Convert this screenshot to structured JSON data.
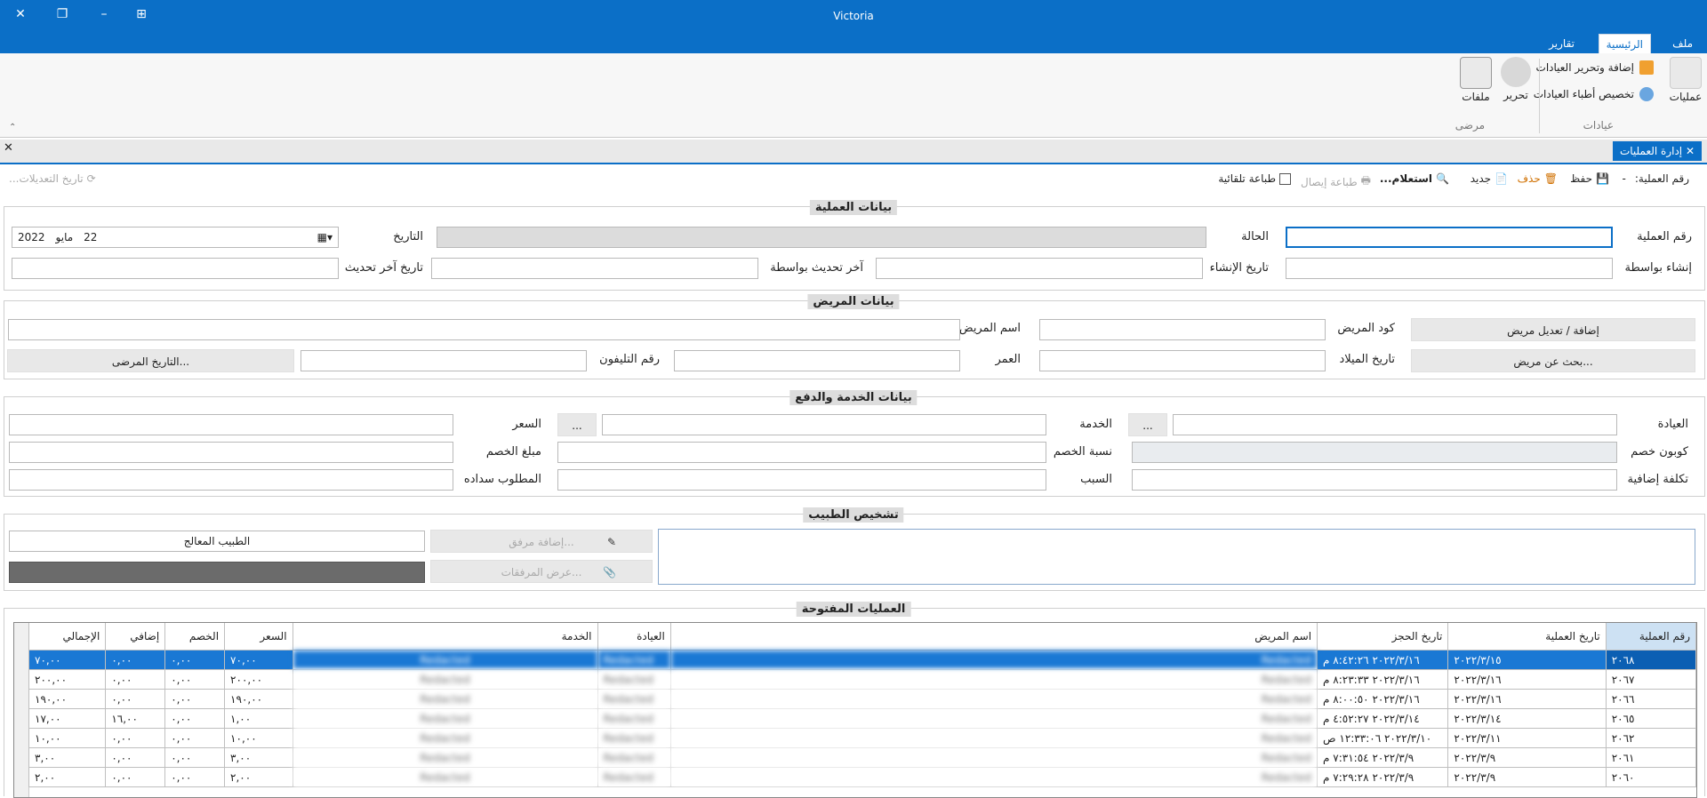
{
  "window": {
    "title": "Victoria"
  },
  "ribbon_tabs": [
    "ملف",
    "الرئيسية",
    "تقارير"
  ],
  "ribbon": {
    "operations_label": "عمليات",
    "add_edit_clinics": "إضافة وتحرير العيادات",
    "assign_doctors": "تخصيص أطباء العيادات",
    "clinics_group": "عيادات",
    "edit_label": "تحرير",
    "files_label": "ملفات",
    "patients_group": "مرضى"
  },
  "doc_tab": {
    "label": "إدارة العمليات"
  },
  "toolbar": {
    "op_number_label": "رقم العملية:",
    "op_number_value": "-",
    "save": "حفظ",
    "delete": "حذف",
    "new": "جديد",
    "inquiry": "استعلام...",
    "print_receipt": "طباعة إيصال",
    "auto_print": "طباعة تلقائية",
    "history": "تاريخ التعديلات..."
  },
  "op_section": {
    "title": "بيانات العملية",
    "op_number": "رقم العملية",
    "status": "الحالة",
    "date": "التاريخ",
    "date_day": "22",
    "date_month": "مايو",
    "date_year": "2022",
    "created_by": "إنشاء بواسطة",
    "created_date": "تاريخ الإنشاء",
    "updated_by": "آخر تحديث بواسطة",
    "updated_date": "تاريخ آخر تحديث"
  },
  "patient_section": {
    "title": "بيانات المريض",
    "add_edit_patient": "إضافة / تعديل مريض",
    "patient_code": "كود المريض",
    "patient_name": "اسم المريض",
    "search_patient": "بحث عن مريض...",
    "birth_date": "تاريخ الميلاد",
    "age": "العمر",
    "phone": "رقم التليفون",
    "patient_history": "التاريخ المرضى..."
  },
  "service_section": {
    "title": "بيانات الخدمة والدفع",
    "clinic": "العيادة",
    "service": "الخدمة",
    "price": "السعر",
    "ellipsis": "...",
    "coupon": "كوبون خصم",
    "discount_pct": "نسبة الخصم",
    "discount_amount": "مبلغ الخصم",
    "extra_cost": "تكلفة إضافية",
    "reason": "السبب",
    "amount_due": "المطلوب سداده"
  },
  "diagnosis_section": {
    "title": "تشخيص الطبيب",
    "add_attachment": "إضافة مرفق...",
    "view_attachments": "عرض المرفقات...",
    "treating_doctor": "الطبيب المعالج"
  },
  "open_ops": {
    "title": "العمليات المفتوحة",
    "columns": [
      "رقم العملية",
      "تاريخ العملية",
      "تاريخ الحجز",
      "اسم المريض",
      "العيادة",
      "الخدمة",
      "السعر",
      "الخصم",
      "إضافي",
      "الإجمالي"
    ],
    "rows": [
      [
        "٢٠٦٨",
        "٢٠٢٢/٣/١٥",
        "٢٠٢٢/٣/١٦ ٨:٤٢:٢٦ م",
        "Redacted",
        "Redacted",
        "Redacted",
        "٧٠,٠٠",
        "٠,٠٠",
        "٠,٠٠",
        "٧٠,٠٠"
      ],
      [
        "٢٠٦٧",
        "٢٠٢٢/٣/١٦",
        "٢٠٢٢/٣/١٦ ٨:٢٣:٣٣ م",
        "Redacted",
        "Redacted",
        "Redacted",
        "٢٠٠,٠٠",
        "٠,٠٠",
        "٠,٠٠",
        "٢٠٠,٠٠"
      ],
      [
        "٢٠٦٦",
        "٢٠٢٢/٣/١٦",
        "٢٠٢٢/٣/١٦ ٨:٠٠:٥٠ م",
        "Redacted",
        "Redacted",
        "Redacted",
        "١٩٠,٠٠",
        "٠,٠٠",
        "٠,٠٠",
        "١٩٠,٠٠"
      ],
      [
        "٢٠٦٥",
        "٢٠٢٢/٣/١٤",
        "٢٠٢٢/٣/١٤ ٤:٥٢:٢٧ م",
        "Redacted",
        "Redacted",
        "Redacted",
        "١,٠٠",
        "٠,٠٠",
        "١٦,٠٠",
        "١٧,٠٠"
      ],
      [
        "٢٠٦٢",
        "٢٠٢٢/٣/١١",
        "٢٠٢٢/٣/١٠ ١٢:٣٣:٠٦ ص",
        "Redacted",
        "Redacted",
        "Redacted",
        "١٠,٠٠",
        "٠,٠٠",
        "٠,٠٠",
        "١٠,٠٠"
      ],
      [
        "٢٠٦١",
        "٢٠٢٢/٣/٩",
        "٢٠٢٢/٣/٩ ٧:٣١:٥٤ م",
        "Redacted",
        "Redacted",
        "Redacted",
        "٣,٠٠",
        "٠,٠٠",
        "٠,٠٠",
        "٣,٠٠"
      ],
      [
        "٢٠٦٠",
        "٢٠٢٢/٣/٩",
        "٢٠٢٢/٣/٩ ٧:٢٩:٢٨ م",
        "Redacted",
        "Redacted",
        "Redacted",
        "٢,٠٠",
        "٠,٠٠",
        "٠,٠٠",
        "٢,٠٠"
      ]
    ]
  },
  "colors": {
    "accent": "#0b6fc7",
    "selected_row": "#1a78d4"
  }
}
